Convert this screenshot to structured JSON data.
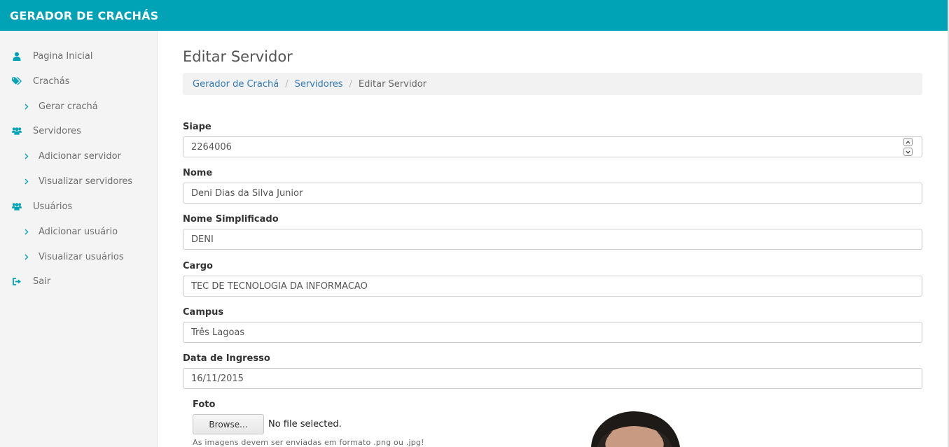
{
  "app": {
    "brand": "GERADOR DE CRACHÁS"
  },
  "sidebar": {
    "items": [
      {
        "label": "Pagina Inicial",
        "icon": "user-icon",
        "sub": false
      },
      {
        "label": "Crachás",
        "icon": "tags-icon",
        "sub": false
      },
      {
        "label": "Gerar crachá",
        "icon": "chevron-right-icon",
        "sub": true
      },
      {
        "label": "Servidores",
        "icon": "users-icon",
        "sub": false
      },
      {
        "label": "Adicionar servidor",
        "icon": "chevron-right-icon",
        "sub": true
      },
      {
        "label": "Visualizar servidores",
        "icon": "chevron-right-icon",
        "sub": true
      },
      {
        "label": "Usuários",
        "icon": "users-icon",
        "sub": false
      },
      {
        "label": "Adicionar usuário",
        "icon": "chevron-right-icon",
        "sub": true
      },
      {
        "label": "Visualizar usuários",
        "icon": "chevron-right-icon",
        "sub": true
      },
      {
        "label": "Sair",
        "icon": "sign-out-icon",
        "sub": false
      }
    ]
  },
  "colors": {
    "topbar": "#00a2b5",
    "accent": "#00a2b5",
    "link": "#337ab7"
  },
  "page": {
    "title": "Editar Servidor"
  },
  "breadcrumb": [
    "Gerador de Crachá",
    "Servidores",
    "Editar Servidor"
  ],
  "form": {
    "siape": {
      "label": "Siape",
      "value": "2264006"
    },
    "nome": {
      "label": "Nome",
      "value": "Deni Dias da Silva Junior"
    },
    "nome_simplificado": {
      "label": "Nome Simplificado",
      "value": "DENI"
    },
    "cargo": {
      "label": "Cargo",
      "value": "TEC DE TECNOLOGIA DA INFORMACAO"
    },
    "campus": {
      "label": "Campus",
      "value": "Três Lagoas"
    },
    "data_ingresso": {
      "label": "Data de Ingresso",
      "value": "16/11/2015"
    },
    "foto": {
      "label": "Foto",
      "browse_label": "Browse...",
      "status": "No file selected.",
      "help": "As imagens devem ser enviadas em formato .png ou .jpg!"
    }
  }
}
